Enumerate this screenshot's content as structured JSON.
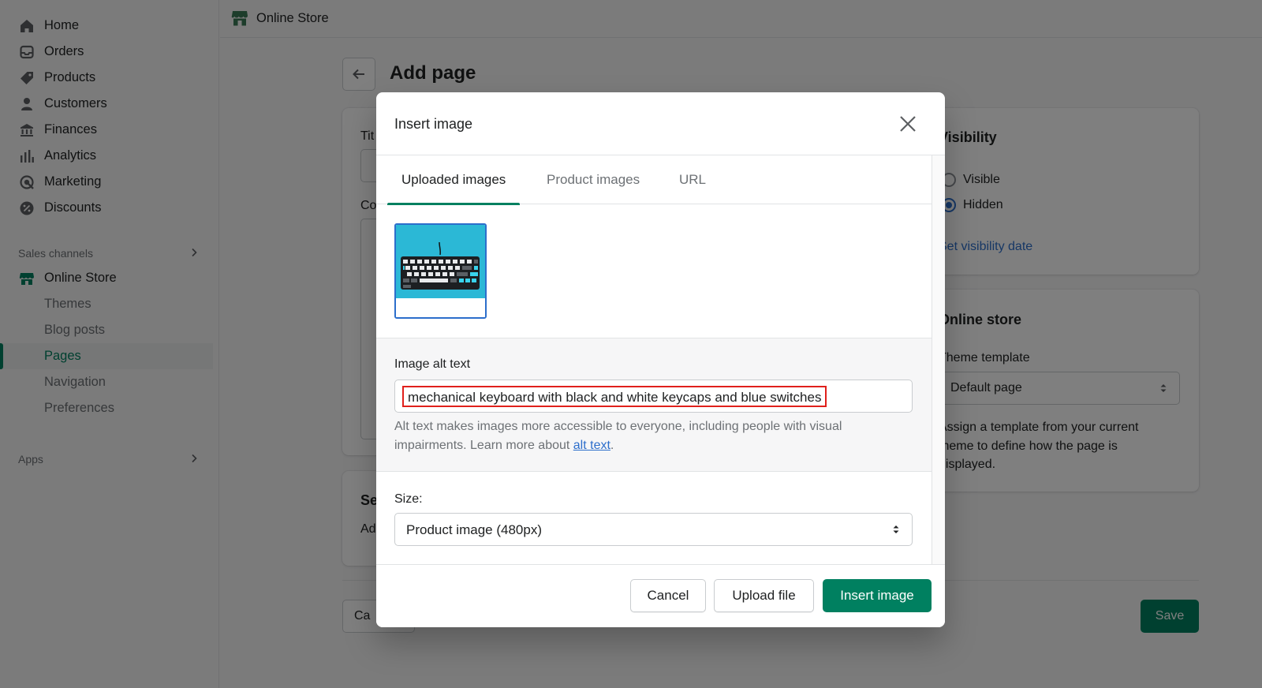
{
  "sidebar": {
    "main_items": [
      {
        "label": "Home",
        "icon": "home-icon"
      },
      {
        "label": "Orders",
        "icon": "orders-icon"
      },
      {
        "label": "Products",
        "icon": "tag-icon"
      },
      {
        "label": "Customers",
        "icon": "person-icon"
      },
      {
        "label": "Finances",
        "icon": "bank-icon"
      },
      {
        "label": "Analytics",
        "icon": "bar-chart-icon"
      },
      {
        "label": "Marketing",
        "icon": "target-icon"
      },
      {
        "label": "Discounts",
        "icon": "discount-icon"
      }
    ],
    "sales_channels_label": "Sales channels",
    "online_store_label": "Online Store",
    "sub_items": [
      "Themes",
      "Blog posts",
      "Pages",
      "Navigation",
      "Preferences"
    ],
    "active_sub_item": "Pages",
    "apps_label": "Apps"
  },
  "topbar": {
    "title": "Online Store"
  },
  "page": {
    "title": "Add page",
    "title_fragment": "Tit",
    "content_fragment": "Co",
    "seo_fragment": "Se",
    "seo_sub_fragment": "Ad",
    "cancel_fragment": "Ca",
    "save_label": "Save"
  },
  "visibility": {
    "title": "Visibility",
    "options": [
      "Visible",
      "Hidden"
    ],
    "selected": "Hidden",
    "set_date_link": "Set visibility date"
  },
  "online_store_card": {
    "title": "Online store",
    "template_label": "Theme template",
    "template_value": "Default page",
    "help": "Assign a template from your current theme to define how the page is displayed."
  },
  "modal": {
    "title": "Insert image",
    "tabs": [
      "Uploaded images",
      "Product images",
      "URL"
    ],
    "active_tab": "Uploaded images",
    "alt_label": "Image alt text",
    "alt_value": "mechanical keyboard with black and white keycaps and blue switches",
    "alt_help_prefix": "Alt text makes images more accessible to everyone, including people with visual impairments. Learn more about ",
    "alt_help_link": "alt text",
    "alt_help_suffix": ".",
    "size_label": "Size:",
    "size_value": "Product image (480px)",
    "cancel_label": "Cancel",
    "upload_label": "Upload file",
    "insert_label": "Insert image"
  },
  "colors": {
    "brand_green": "#008060",
    "link_blue": "#2c6ecb",
    "highlight_red": "#e0201b"
  }
}
